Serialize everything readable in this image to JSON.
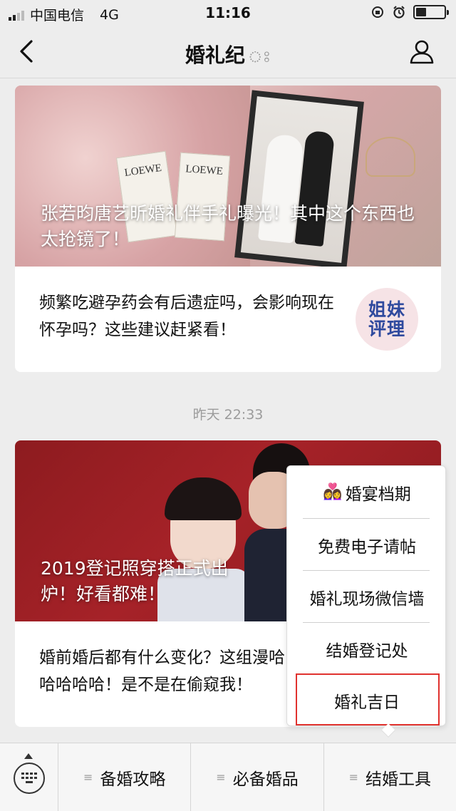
{
  "status_bar": {
    "carrier": "中国电信",
    "network": "4G",
    "time": "11:16"
  },
  "nav": {
    "title": "婚礼纪",
    "title_suffix_icon": "ear-icon",
    "back_icon": "chevron-left-icon",
    "profile_icon": "user-icon"
  },
  "feed": [
    {
      "hero_caption": "张若昀唐艺昕婚礼伴手礼曝光！其中这个东西也太抢镜了！",
      "item_text": "频繁吃避孕药会有后遗症吗，会影响现在怀孕吗？这些建议赶紧看！",
      "avatar_text": [
        "姐妹",
        "评理"
      ]
    },
    {
      "timestamp": "昨天 22:33",
      "hero_caption": "2019登记照穿搭正式出炉！好看都难！",
      "item_text": "婚前婚后都有什么变化？这组漫哈哈哈哈哈！是不是在偷窥我！"
    }
  ],
  "hero1_labels": [
    "LOEWE",
    "LOEWE"
  ],
  "popup_menu": {
    "items": [
      {
        "label": "婚宴档期",
        "icon": "couple-emoji"
      },
      {
        "label": "免费电子请帖"
      },
      {
        "label": "婚礼现场微信墙"
      },
      {
        "label": "结婚登记处"
      },
      {
        "label": "婚礼吉日",
        "highlighted": true
      }
    ],
    "highlight_color": "#e0322e"
  },
  "bottom_bar": {
    "keyboard_icon": "keyboard-icon",
    "tabs": [
      "备婚攻略",
      "必备婚品",
      "结婚工具"
    ]
  }
}
